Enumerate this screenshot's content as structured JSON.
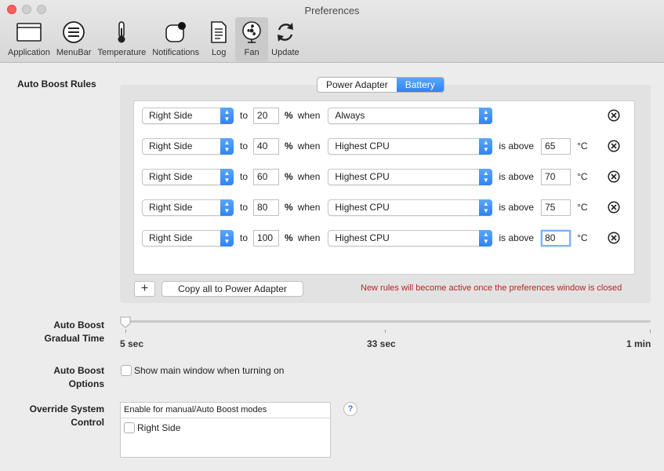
{
  "window": {
    "title": "Preferences"
  },
  "toolbar": {
    "items": [
      {
        "label": "Application",
        "icon": "application-icon"
      },
      {
        "label": "MenuBar",
        "icon": "menubar-icon"
      },
      {
        "label": "Temperature",
        "icon": "thermometer-icon"
      },
      {
        "label": "Notifications",
        "icon": "notifications-icon"
      },
      {
        "label": "Log",
        "icon": "log-icon"
      },
      {
        "label": "Fan",
        "icon": "fan-icon",
        "selected": true
      },
      {
        "label": "Update",
        "icon": "update-icon"
      }
    ]
  },
  "auto_boost_rules": {
    "label": "Auto Boost  Rules",
    "tabs": [
      {
        "label": "Power Adapter",
        "selected": false
      },
      {
        "label": "Battery",
        "selected": true
      }
    ],
    "connectors": {
      "to": "to",
      "percent": "%",
      "when": "when",
      "is_above": "is above",
      "unit": "°C"
    },
    "rules": [
      {
        "fan": "Right Side",
        "speed": "20",
        "condition": "Always",
        "threshold": ""
      },
      {
        "fan": "Right Side",
        "speed": "40",
        "condition": "Highest CPU",
        "threshold": "65"
      },
      {
        "fan": "Right Side",
        "speed": "60",
        "condition": "Highest CPU",
        "threshold": "70"
      },
      {
        "fan": "Right Side",
        "speed": "80",
        "condition": "Highest CPU",
        "threshold": "75"
      },
      {
        "fan": "Right Side",
        "speed": "100",
        "condition": "Highest CPU",
        "threshold": "80"
      }
    ],
    "add_label": "+",
    "copy_label": "Copy all to Power Adapter",
    "notice": "New rules will become active once the preferences window is closed"
  },
  "gradual_time": {
    "label_line1": "Auto Boost",
    "label_line2": "Gradual Time",
    "min_label": "5 sec",
    "mid_label": "33 sec",
    "max_label": "1 min",
    "value_fraction": 0.0
  },
  "options": {
    "label_line1": "Auto Boost",
    "label_line2": "Options",
    "checkbox_label": "Show main window when turning on",
    "checked": false
  },
  "override": {
    "label_line1": "Override System",
    "label_line2": "Control",
    "header": "Enable for manual/Auto Boost modes",
    "item_label": "Right Side",
    "checked": false,
    "help_label": "?"
  },
  "colors": {
    "accent": "#2f84f4",
    "notice": "#b52525",
    "close": "#fc605c"
  }
}
